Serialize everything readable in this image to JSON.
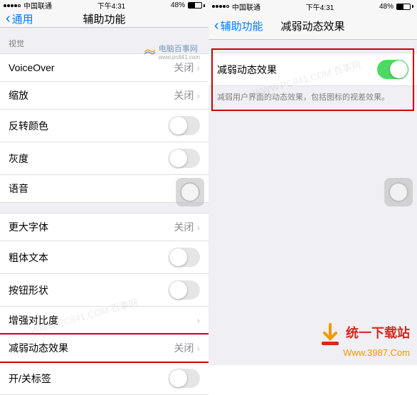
{
  "statusBar": {
    "carrier": "中国联通",
    "time": "下午4:31",
    "batteryPct": "48%"
  },
  "left": {
    "back": "通用",
    "title": "辅助功能",
    "section1": "视觉",
    "rows": {
      "voiceover": {
        "label": "VoiceOver",
        "value": "关闭"
      },
      "zoom": {
        "label": "缩放",
        "value": "关闭"
      },
      "invert": {
        "label": "反转颜色"
      },
      "grayscale": {
        "label": "灰度"
      },
      "speech": {
        "label": "语音"
      },
      "largerText": {
        "label": "更大字体",
        "value": "关闭"
      },
      "boldText": {
        "label": "粗体文本"
      },
      "buttonShapes": {
        "label": "按钮形状"
      },
      "contrast": {
        "label": "增强对比度"
      },
      "reduceMotion": {
        "label": "减弱动态效果",
        "value": "关闭"
      },
      "labels": {
        "label": "开/关标签"
      }
    }
  },
  "right": {
    "back": "辅助功能",
    "title": "减弱动态效果",
    "row": {
      "label": "减弱动态效果"
    },
    "desc": "减弱用户界面的动态效果，包括图标的视差效果。"
  },
  "watermarks": {
    "pc841": "WWW.PC841.COM 百事网",
    "pc841b": "电脑百事网",
    "pc841url": "www.pc841.com",
    "dlName": "统一下载站",
    "dlUrl": "Www.3987.Com"
  }
}
